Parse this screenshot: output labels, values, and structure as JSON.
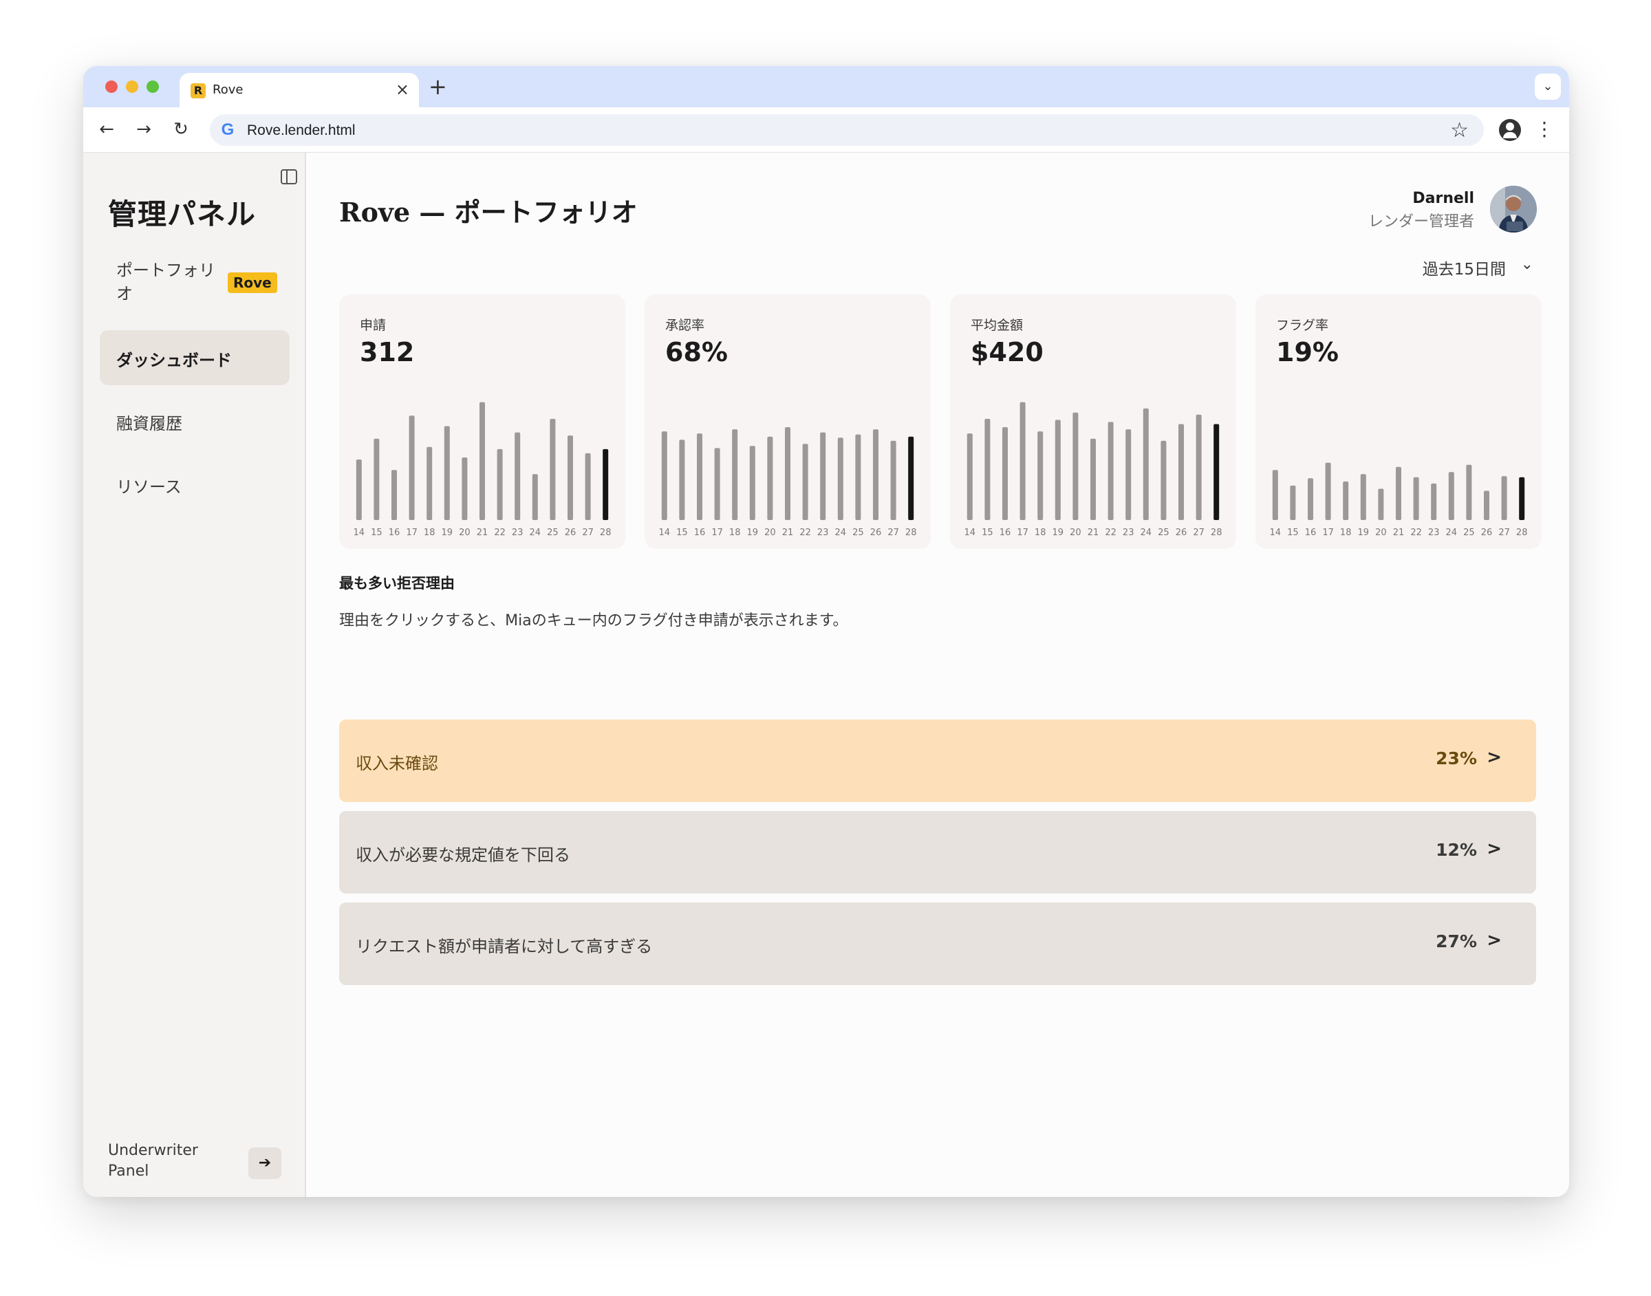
{
  "browser": {
    "tab_title": "Rove",
    "tab_favicon": "R",
    "url": "Rove.lender.html",
    "new_tab": "+",
    "close": "×"
  },
  "sidebar": {
    "title": "管理パネル",
    "items": [
      {
        "label": "ポートフォリオ",
        "badge": "Rove"
      },
      {
        "label": "ダッシュボード",
        "active": true
      },
      {
        "label": "融資履歴"
      },
      {
        "label": "リソース"
      }
    ],
    "switch_label": "Underwriter Panel",
    "switch_icon": "arrow-right-icon"
  },
  "header": {
    "title": "Rove — ポートフォリオ",
    "user_name": "Darnell",
    "user_role": "レンダー管理者",
    "period": "過去15日間"
  },
  "metrics": [
    {
      "label": "申請",
      "value": "312"
    },
    {
      "label": "承認率",
      "value": "68%"
    },
    {
      "label": "平均金額",
      "value": "$420"
    },
    {
      "label": "フラグ率",
      "value": "19%"
    }
  ],
  "chart_data": [
    {
      "type": "bar",
      "title": "申請",
      "categories": [
        "14",
        "15",
        "16",
        "17",
        "18",
        "19",
        "20",
        "21",
        "22",
        "23",
        "24",
        "25",
        "26",
        "27",
        "28"
      ],
      "values": [
        58,
        78,
        48,
        100,
        70,
        90,
        60,
        113,
        68,
        84,
        44,
        97,
        81,
        64,
        68
      ],
      "highlight_last": true,
      "colors": {
        "bar": "#9c9898",
        "highlight": "#161616"
      }
    },
    {
      "type": "bar",
      "title": "承認率",
      "categories": [
        "14",
        "15",
        "16",
        "17",
        "18",
        "19",
        "20",
        "21",
        "22",
        "23",
        "24",
        "25",
        "26",
        "27",
        "28"
      ],
      "values": [
        85,
        77,
        83,
        69,
        87,
        71,
        80,
        89,
        73,
        84,
        79,
        82,
        87,
        76,
        80
      ],
      "highlight_last": true,
      "colors": {
        "bar": "#9c9898",
        "highlight": "#161616"
      }
    },
    {
      "type": "bar",
      "title": "平均金額",
      "categories": [
        "14",
        "15",
        "16",
        "17",
        "18",
        "19",
        "20",
        "21",
        "22",
        "23",
        "24",
        "25",
        "26",
        "27",
        "28"
      ],
      "values": [
        83,
        97,
        89,
        113,
        85,
        96,
        103,
        78,
        94,
        87,
        107,
        76,
        92,
        101,
        92
      ],
      "highlight_last": true,
      "colors": {
        "bar": "#9c9898",
        "highlight": "#161616"
      }
    },
    {
      "type": "bar",
      "title": "フラグ率",
      "categories": [
        "14",
        "15",
        "16",
        "17",
        "18",
        "19",
        "20",
        "21",
        "22",
        "23",
        "24",
        "25",
        "26",
        "27",
        "28"
      ],
      "values": [
        48,
        33,
        40,
        55,
        37,
        44,
        30,
        51,
        41,
        35,
        46,
        53,
        28,
        42,
        41
      ],
      "highlight_last": true,
      "colors": {
        "bar": "#9c9898",
        "highlight": "#161616"
      }
    }
  ],
  "reasons_section": {
    "title": "最も多い拒否理由",
    "description": "理由をクリックすると、Miaのキュー内のフラグ付き申請が表示されます。",
    "items": [
      {
        "label": "収入未確認",
        "pct": "23%",
        "arrow": ">",
        "active": true
      },
      {
        "label": "収入が必要な規定値を下回る",
        "pct": "12%",
        "arrow": ">"
      },
      {
        "label": "リクエスト額が申請者に対して高すぎる",
        "pct": "27%",
        "arrow": ">"
      }
    ]
  },
  "colors": {
    "accent_badge": "#f5bc1c",
    "active_reason": "#fde0b9",
    "reason_bg": "#e7e2dd",
    "tabstrip": "#d7e3fc"
  }
}
